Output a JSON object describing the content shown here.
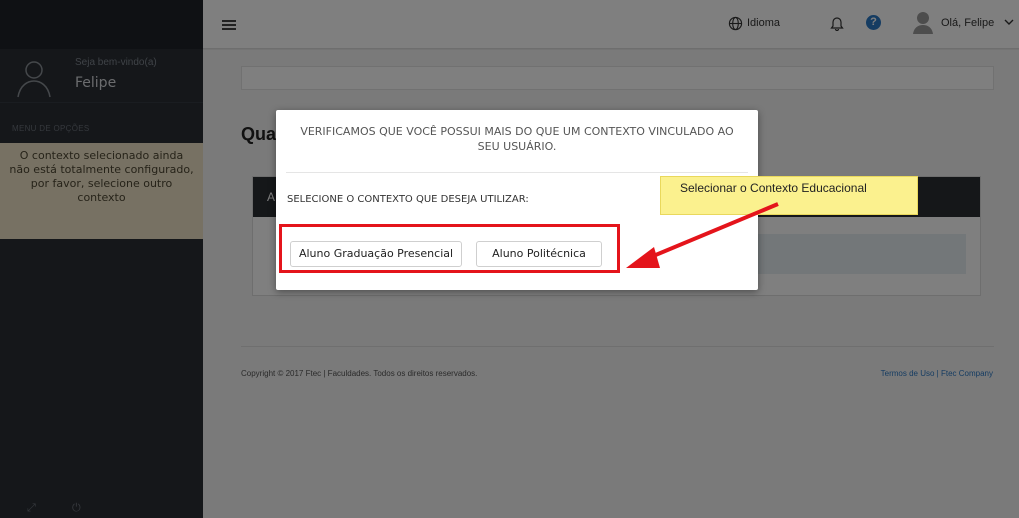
{
  "sidebar": {
    "welcome": "Seja bem-vindo(a)",
    "user_name": "Felipe",
    "menu_title": "MENU DE OPÇÕES",
    "warning": "O contexto selecionado ainda não está totalmente configurado, por favor, selecione outro contexto"
  },
  "topbar": {
    "language_label": "Idioma",
    "greeting": "Olá, Felipe",
    "help_symbol": "?"
  },
  "main": {
    "heading": "Qua",
    "card_header": "A",
    "footer_copyright": "Copyright © 2017 Ftec | Faculdades. Todos os direitos reservados.",
    "footer_links": "Termos de Uso   |   Ftec Company"
  },
  "modal": {
    "title": "VERIFICAMOS QUE VOCÊ POSSUI MAIS DO QUE UM CONTEXTO VINCULADO AO SEU USUÁRIO.",
    "subtitle": "SELECIONE O CONTEXTO QUE DESEJA UTILIZAR:",
    "options": [
      {
        "label": "Aluno Graduação Presencial"
      },
      {
        "label": "Aluno Politécnica"
      }
    ]
  },
  "annotation": {
    "callout_text": "Selecionar o Contexto Educacional",
    "highlight_color": "#e4141b",
    "callout_color": "#fbf18e"
  },
  "icons": [
    "menu-icon",
    "globe-icon",
    "bell-icon",
    "help-icon",
    "user-icon",
    "chevron-down-icon",
    "avatar-icon",
    "expand-icon",
    "power-icon"
  ]
}
